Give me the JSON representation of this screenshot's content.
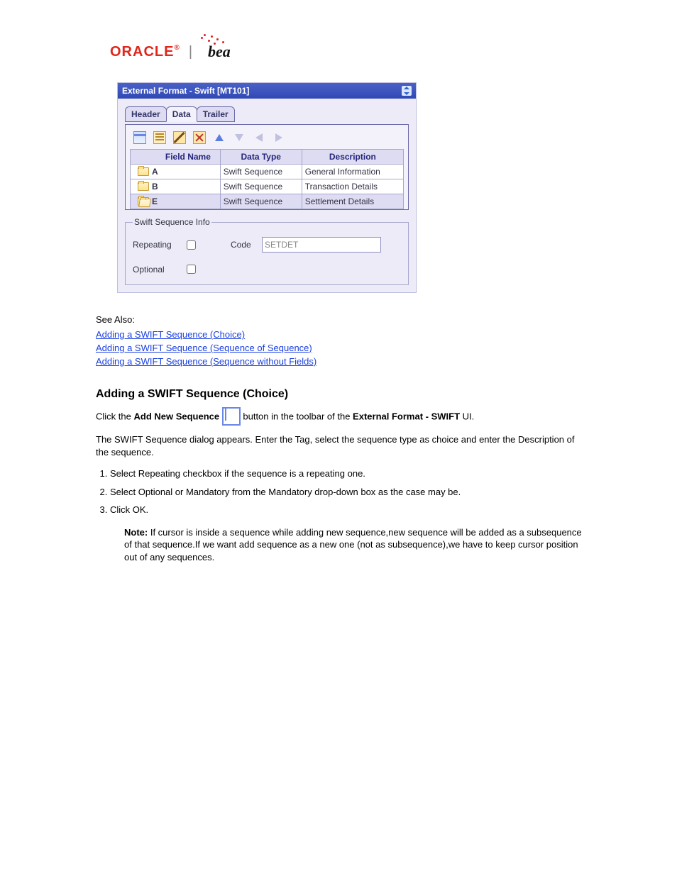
{
  "logo": {
    "oracle": "ORACLE",
    "bea": "bea"
  },
  "panel": {
    "title": "External Format - Swift [MT101]",
    "tabs": [
      "Header",
      "Data",
      "Trailer"
    ],
    "activeTab": 1,
    "columns": [
      "Field Name",
      "Data Type",
      "Description"
    ],
    "rows": [
      {
        "name": "A",
        "type": "Swift Sequence",
        "desc": "General Information",
        "open": false
      },
      {
        "name": "B",
        "type": "Swift Sequence",
        "desc": "Transaction Details",
        "open": false
      },
      {
        "name": "E",
        "type": "Swift Sequence",
        "desc": "Settlement Details",
        "open": true,
        "selected": true
      }
    ],
    "fieldset": {
      "legend": "Swift Sequence Info",
      "repeating_label": "Repeating",
      "code_label": "Code",
      "code_value": "SETDET",
      "optional_label": "Optional"
    }
  },
  "seeAlso": {
    "label": "See Also:",
    "links": [
      "Adding a SWIFT Sequence (Choice)",
      "Adding a SWIFT Sequence (Sequence of Sequence)",
      "Adding a SWIFT Sequence (Sequence without Fields)"
    ]
  },
  "section": {
    "heading": "Adding a SWIFT Sequence (Choice)",
    "intro_before": "Click the",
    "intro_strong": "Add New Sequence",
    "intro_after_icon": " button in the toolbar of the ",
    "intro_strong2": "External Format - SWIFT",
    "intro_after2": " UI.",
    "p2": "The SWIFT Sequence dialog appears. Enter the Tag, select the sequence type as choice and enter the Description of the sequence.",
    "steps": [
      "Select Repeating checkbox if the sequence is a repeating one.",
      "Select Optional or Mandatory from the Mandatory drop-down box as the case may be.",
      "Click OK."
    ],
    "note_label": "Note:",
    "note_text": "If cursor is inside a sequence while adding new sequence,new sequence will be added as a subsequence of that sequence.If we want add sequence as a new one (not as subsequence),we have to keep cursor position out of any sequences."
  }
}
